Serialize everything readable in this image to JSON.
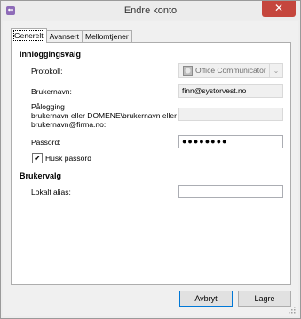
{
  "window": {
    "title": "Endre konto",
    "close_label": "✕"
  },
  "tabs": [
    {
      "label": "Generelt",
      "active": true
    },
    {
      "label": "Avansert",
      "active": false
    },
    {
      "label": "Mellomtjener",
      "active": false
    }
  ],
  "login_section": {
    "title": "Innloggingsvalg",
    "protocol_label": "Protokoll:",
    "protocol_value": "Office Communicator",
    "username_label": "Brukernavn:",
    "username_value": "finn@systorvest.no",
    "logon_label_line1": "Pålogging",
    "logon_label_line2": "brukernavn eller DOMENE\\brukernavn eller",
    "logon_label_line3": "brukernavn@firma.no:",
    "logon_value": "",
    "password_label": "Passord:",
    "password_value": "●●●●●●●●",
    "remember_label": "Husk passord",
    "remember_checked": "✔"
  },
  "user_section": {
    "title": "Brukervalg",
    "alias_label": "Lokalt alias:",
    "alias_value": ""
  },
  "buttons": {
    "cancel": "Avbryt",
    "save": "Lagre"
  },
  "icons": {
    "app": "pidgin-icon",
    "protocol": "office-communicator-icon",
    "dropdown": "chevron-down-icon"
  }
}
